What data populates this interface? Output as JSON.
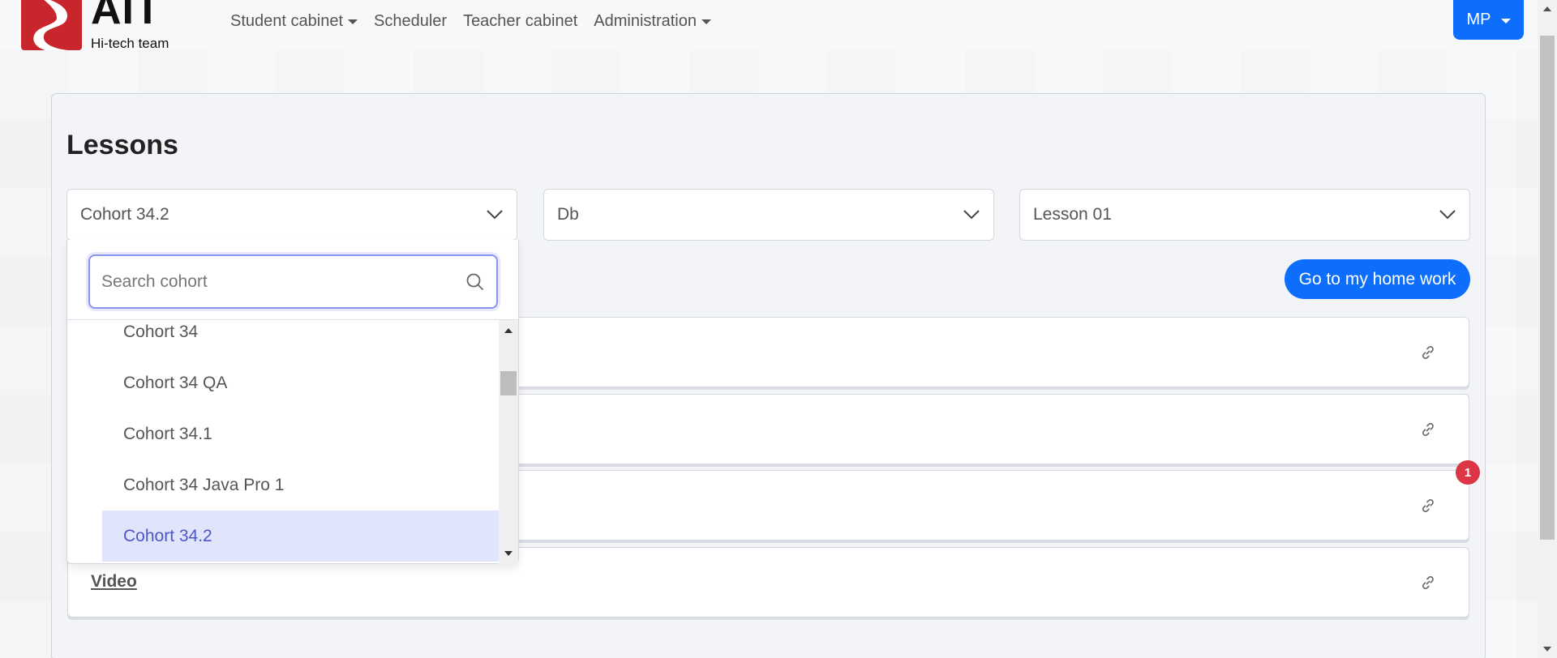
{
  "header": {
    "logo_text": "AIT",
    "logo_sub": "Hi-tech team",
    "nav": [
      {
        "label": "Student cabinet",
        "dropdown": true
      },
      {
        "label": "Scheduler",
        "dropdown": false
      },
      {
        "label": "Teacher cabinet",
        "dropdown": false
      },
      {
        "label": "Administration",
        "dropdown": true
      }
    ],
    "user_initials": "MP"
  },
  "main": {
    "title": "Lessons",
    "selects": {
      "cohort": "Cohort 34.2",
      "module": "Db",
      "lesson": "Lesson 01"
    },
    "home_work_button": "Go to my home work",
    "rows": [
      {
        "label": "",
        "icon": "link-icon"
      },
      {
        "label": "",
        "icon": "link-icon"
      },
      {
        "label": "",
        "icon": "link-icon"
      },
      {
        "label": "Video",
        "icon": "link-icon"
      }
    ],
    "notification_badge": "1"
  },
  "cohort_dropdown": {
    "search_placeholder": "Search cohort",
    "items": [
      "Cohort 34",
      "Cohort 34 QA",
      "Cohort 34.1",
      "Cohort 34 Java Pro 1",
      "Cohort 34.2"
    ],
    "selected": "Cohort 34.2"
  },
  "colors": {
    "primary": "#0d6efd",
    "logo_red": "#c9252c",
    "badge_red": "#dc3545",
    "selected_bg": "#e0e5fb",
    "selected_text": "#4d57c7"
  }
}
